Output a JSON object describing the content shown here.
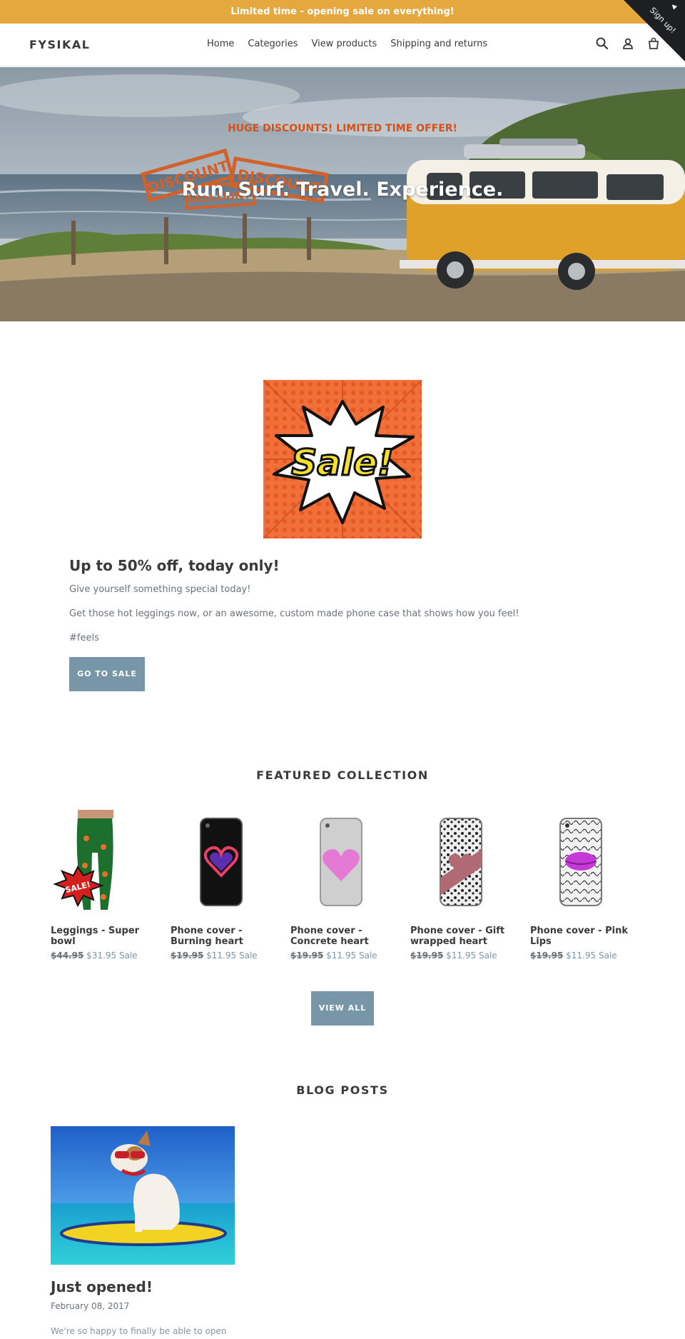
{
  "announcement": {
    "text": "Limited time - opening sale on everything!",
    "corner_label": "Sign up!"
  },
  "header": {
    "logo": "FYSIKAL",
    "nav": [
      "Home",
      "Categories",
      "View products",
      "Shipping and returns"
    ],
    "icons": [
      "search-icon",
      "account-icon",
      "cart-icon"
    ]
  },
  "hero": {
    "subtitle": "HUGE DISCOUNTS! LIMITED TIME OFFER!",
    "title": "Run. Surf. Travel. Experience.",
    "stamp_text": "DISCOUNT"
  },
  "promo": {
    "image_text": "Sale!",
    "heading": "Up to 50% off, today only!",
    "paragraphs": [
      "Give yourself something special today!",
      "Get those hot leggings now, or an awesome, custom made phone case that shows how you feel!",
      "#feels"
    ],
    "button": "GO TO SALE"
  },
  "featured": {
    "title": "FEATURED COLLECTION",
    "products": [
      {
        "name": "Leggings - Super bowl",
        "old_price": "$44.95",
        "price": "$31.95",
        "badge": "Sale",
        "image_badge": "SALE!"
      },
      {
        "name": "Phone cover - Burning heart",
        "old_price": "$19.95",
        "price": "$11.95",
        "badge": "Sale"
      },
      {
        "name": "Phone cover - Concrete heart",
        "old_price": "$19.95",
        "price": "$11.95",
        "badge": "Sale"
      },
      {
        "name": "Phone cover - Gift wrapped heart",
        "old_price": "$19.95",
        "price": "$11.95",
        "badge": "Sale"
      },
      {
        "name": "Phone cover - Pink Lips",
        "old_price": "$19.95",
        "price": "$11.95",
        "badge": "Sale"
      }
    ],
    "view_all": "VIEW ALL"
  },
  "blog": {
    "title": "BLOG POSTS",
    "posts": [
      {
        "title": "Just opened!",
        "date": "February 08, 2017",
        "excerpt": "We're so happy to finally be able to open"
      }
    ]
  },
  "colors": {
    "announcement": "#e4a83e",
    "button": "#7796a8",
    "hero_subtitle": "#d3521a",
    "text": "#3a3a3a",
    "muted": "#69727b"
  }
}
